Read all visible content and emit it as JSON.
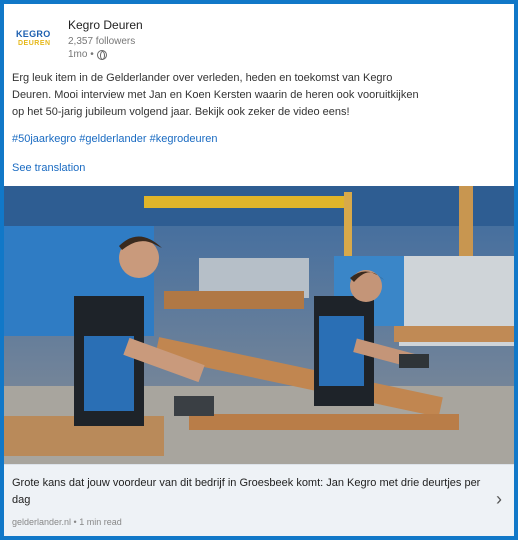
{
  "post": {
    "company_name": "Kegro Deuren",
    "followers": "2,357 followers",
    "meta_time": "1mo •",
    "logo_line1": "KEGRO",
    "logo_line2": "DEUREN",
    "body_line1": "Erg leuk item in de Gelderlander over verleden, heden en toekomst van Kegro",
    "body_line2": "Deuren. Mooi interview met Jan en Koen Kersten waarin de heren ook vooruitkijken",
    "body_line3": "op het 50-jarig jubileum volgend jaar. Bekijk ook zeker de video eens!",
    "hashtags": "#50jaarkegro #gelderlander #kegrodeuren",
    "see_translation": "See translation"
  },
  "link_card": {
    "title": "Grote kans dat jouw voordeur van dit bedrijf in Groesbeek komt: Jan Kegro met drie deurtjes per dag",
    "source": "gelderlander.nl • 1 min read",
    "chevron": "›"
  },
  "icons": [
    "globe-icon",
    "chevron-right-icon"
  ],
  "colors": {
    "frame": "#1178c8",
    "link": "#1a6bc2",
    "logo_blue": "#1c5fb0",
    "logo_yellow": "#e6b818"
  }
}
